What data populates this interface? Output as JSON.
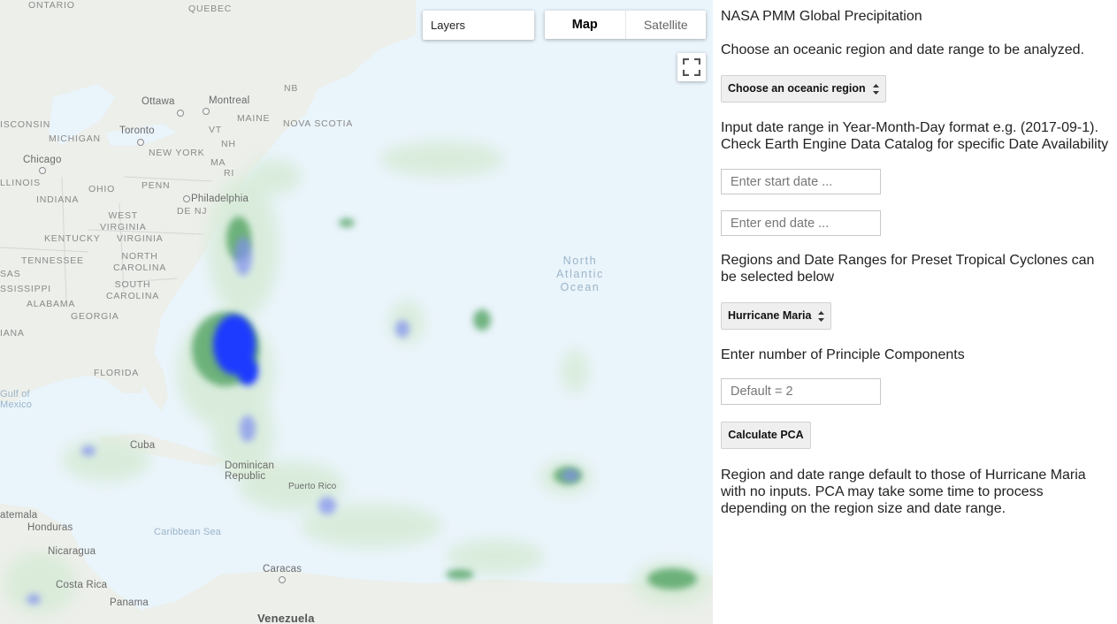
{
  "map": {
    "layers_label": "Layers",
    "map_type": {
      "map_label": "Map",
      "satellite_label": "Satellite",
      "selected": "Map"
    },
    "fullscreen_icon": "fullscreen-icon",
    "labels": {
      "ontario": "ONTARIO",
      "quebec": "QUEBEC",
      "ottawa": "Ottawa",
      "montreal": "Montreal",
      "maine": "MAINE",
      "nb": "NB",
      "wisconsin": "ISCONSIN",
      "michigan": "MICHIGAN",
      "toronto": "Toronto",
      "vt": "VT",
      "nh": "NH",
      "nova_scotia": "NOVA SCOTIA",
      "new_york": "NEW YORK",
      "ma": "MA",
      "chicago": "Chicago",
      "ri": "RI",
      "illinois": "LLINOIS",
      "ohio": "OHIO",
      "penn": "PENN",
      "philadelphia": "Philadelphia",
      "indiana": "INDIANA",
      "de_nj": "DE NJ",
      "west_virginia": "WEST\nVIRGINIA",
      "kentucky": "KENTUCKY",
      "virginia": "VIRGINIA",
      "tennessee": "TENNESSEE",
      "north_carolina": "NORTH\nCAROLINA",
      "sas": "SAS",
      "ssissippi": "SSISSIPPI",
      "south_carolina": "SOUTH\nCAROLINA",
      "alabama": "ALABAMA",
      "georgia": "GEORGIA",
      "iana": "IANA",
      "florida": "FLORIDA",
      "gulf_of_mexico": "Gulf of\nMexico",
      "north_atlantic": "North\nAtlantic\nOcean",
      "cuba": "Cuba",
      "dominican_republic": "Dominican\nRepublic",
      "puerto_rico": "Puerto Rico",
      "guatemala": "atemala",
      "honduras": "Honduras",
      "caribbean_sea": "Caribbean Sea",
      "nicaragua": "Nicaragua",
      "caracas": "Caracas",
      "costa_rica": "Costa Rica",
      "panama": "Panama",
      "venezuela": "Venezuela"
    }
  },
  "panel": {
    "title": "NASA PMM Global Precipitation",
    "intro": "Choose an oceanic region and date range to be analyzed.",
    "region_select": {
      "value": "Choose an oceanic region"
    },
    "date_instructions": "Input date range in Year-Month-Day format e.g. (2017-09-1). Check Earth Engine Data Catalog for specific Date Availability",
    "start_date": {
      "placeholder": "Enter start date ...",
      "value": ""
    },
    "end_date": {
      "placeholder": "Enter end date ...",
      "value": ""
    },
    "preset_text": "Regions and Date Ranges for Preset Tropical Cyclones can be selected below",
    "cyclone_select": {
      "value": "Hurricane Maria"
    },
    "pc_label": "Enter number of Principle Components",
    "pc_input": {
      "placeholder": "Default = 2",
      "value": ""
    },
    "calculate_button": "Calculate PCA",
    "footer_note": "Region and date range default to those of Hurricane Maria with no inputs. PCA may take some time to process depending on the region size and date range."
  },
  "colors": {
    "land": "#ecefea",
    "ocean": "#eaf4fb",
    "precip_light": "#cfe6cf",
    "precip_green": "#2e8b3f",
    "precip_blue": "#1f3bff"
  }
}
